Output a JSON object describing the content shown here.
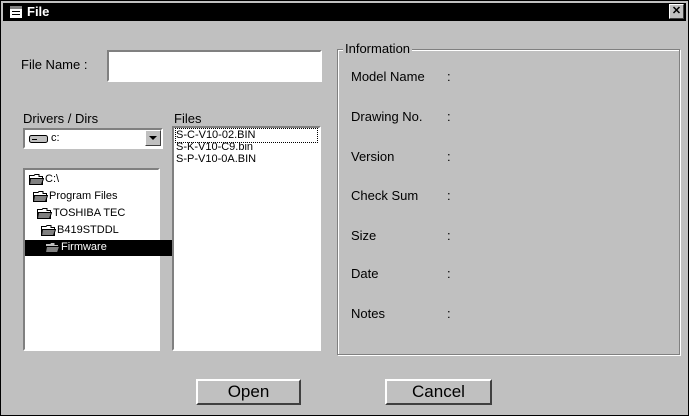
{
  "window": {
    "title": "File",
    "close_label": "✕"
  },
  "file_name": {
    "label": "File Name :",
    "value": ""
  },
  "drivers": {
    "label": "Drivers / Dirs",
    "selected_drive": "c:",
    "dirs": [
      "C:\\",
      "Program Files",
      "TOSHIBA TEC",
      "B419STDDL",
      "Firmware"
    ],
    "selected_dir": "Firmware"
  },
  "files": {
    "label": "Files",
    "items": [
      "S-C-V10-02.BIN",
      "S-K-V10-C9.bin",
      "S-P-V10-0A.BIN"
    ],
    "focused": "S-C-V10-02.BIN"
  },
  "information": {
    "legend": "Information",
    "fields": [
      {
        "label": "Model Name",
        "sep": ":",
        "value": ""
      },
      {
        "label": "Drawing No.",
        "sep": ":",
        "value": ""
      },
      {
        "label": "Version",
        "sep": ":",
        "value": ""
      },
      {
        "label": "Check Sum",
        "sep": ":",
        "value": ""
      },
      {
        "label": "Size",
        "sep": ":",
        "value": ""
      },
      {
        "label": "Date",
        "sep": ":",
        "value": ""
      },
      {
        "label": "Notes",
        "sep": ":",
        "value": ""
      }
    ]
  },
  "buttons": {
    "open": "Open",
    "cancel": "Cancel"
  },
  "colors": {
    "titlebar": "#000000",
    "face": "#c0c0c0",
    "selection": "#000000"
  },
  "icons": {
    "title": "file-dialog-icon",
    "drive": "hard-drive-icon",
    "folder": "folder-icon"
  }
}
